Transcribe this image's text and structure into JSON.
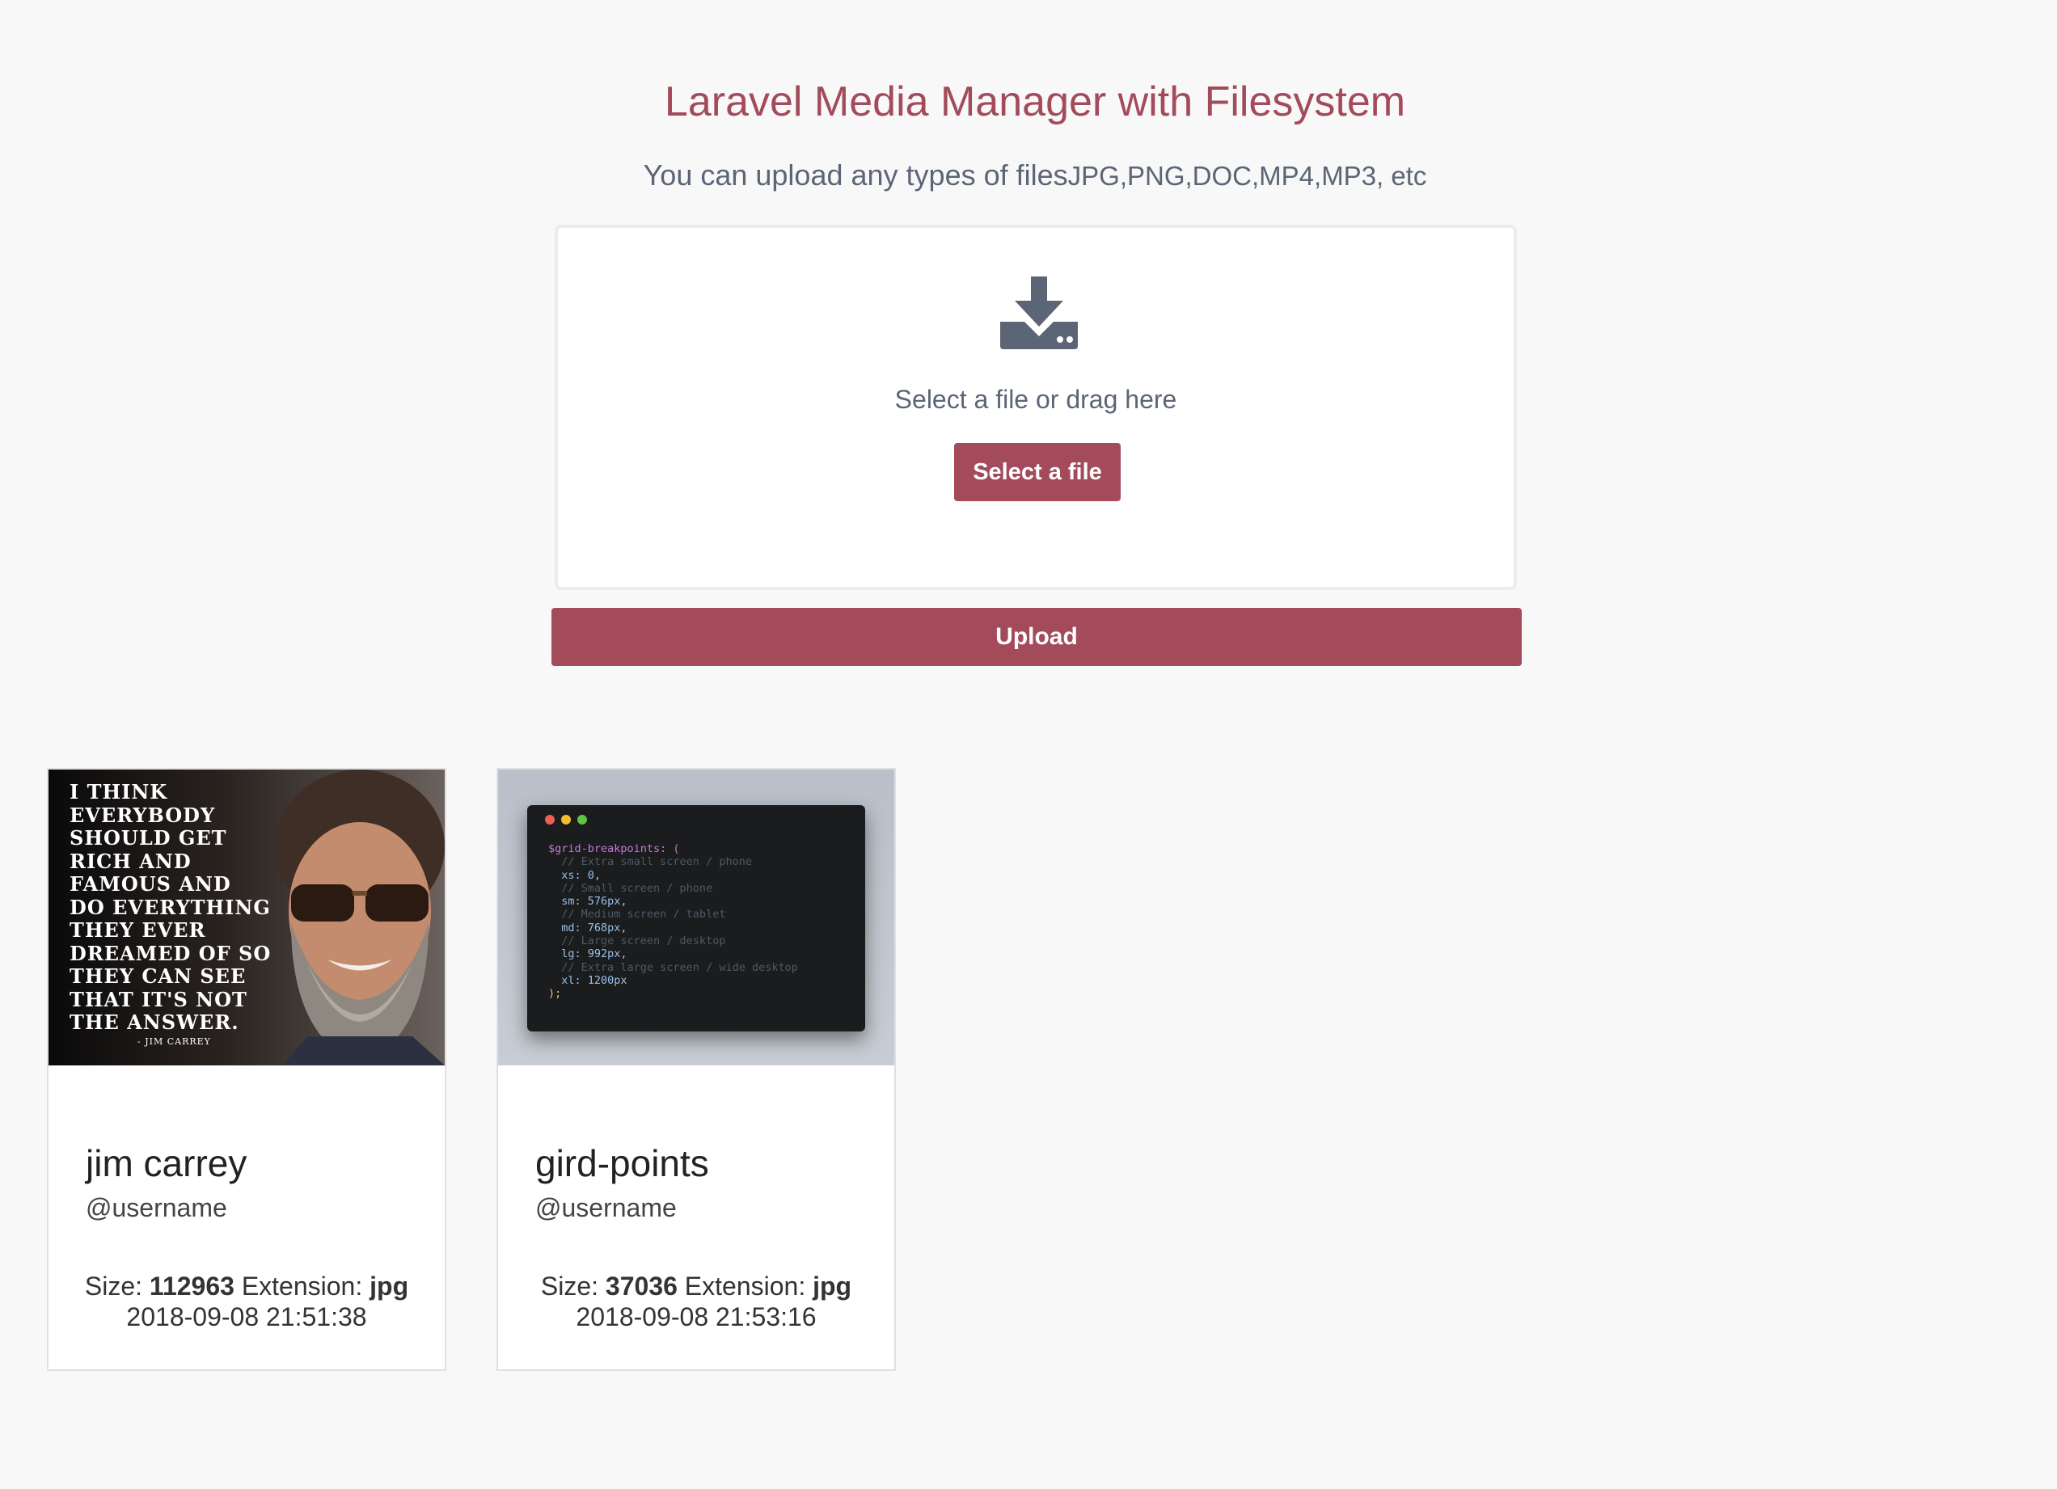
{
  "header": {
    "title": "Laravel Media Manager with Filesystem",
    "subtitle_prefix": "You can upload any types of files",
    "subtitle_types": "JPG,PNG,DOC,MP4,MP3, etc"
  },
  "dropzone": {
    "icon": "download-tray-icon",
    "text": "Select a file or drag here",
    "select_button": "Select a file"
  },
  "upload_button": "Upload",
  "colors": {
    "accent": "#a34b5b",
    "text_muted": "#5c6576",
    "background": "#f8f8f8"
  },
  "media": [
    {
      "title": "jim carrey",
      "username": "@username",
      "size_label": "Size:",
      "size": "112963",
      "extension_label": "Extension:",
      "extension": "jpg",
      "date": "2018-09-08 21:51:38",
      "image": {
        "quote": [
          "I THINK",
          "EVERYBODY",
          "SHOULD GET",
          "RICH AND",
          "FAMOUS AND",
          "DO EVERYTHING",
          "THEY EVER",
          "DREAMED OF SO",
          "THEY CAN SEE",
          "THAT IT'S NOT",
          "THE ANSWER."
        ],
        "attribution": "- JIM CARREY"
      }
    },
    {
      "title": "gird-points",
      "username": "@username",
      "size_label": "Size:",
      "size": "37036",
      "extension_label": "Extension:",
      "extension": "jpg",
      "date": "2018-09-08 21:53:16",
      "image": {
        "code_lines": [
          "$grid-breakpoints: (",
          "  // Extra small screen / phone",
          "  xs: 0,",
          "  // Small screen / phone",
          "  sm: 576px,",
          "  // Medium screen / tablet",
          "  md: 768px,",
          "  // Large screen / desktop",
          "  lg: 992px,",
          "  // Extra large screen / wide desktop",
          "  xl: 1200px",
          ");"
        ]
      }
    }
  ]
}
